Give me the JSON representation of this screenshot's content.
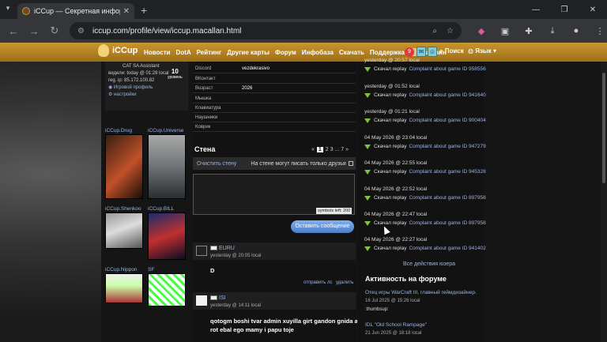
{
  "browser": {
    "tab_title": "iCCup — Секретная инфор",
    "url": "iccup.com/profile/view/iccup.macallan.html"
  },
  "sitenav": {
    "logo": "iCCup",
    "items": [
      "Новости",
      "DotA",
      "Рейтинг",
      "Другие карты",
      "Форум",
      "Инфобаза",
      "Скачать",
      "Поддержка",
      "Магазин"
    ],
    "badge": "9",
    "search": "Поиск",
    "lang": "Язык"
  },
  "profile": {
    "role": "CAT SA Assistant",
    "seen": "видели: today @ 01:28 local",
    "reg": "reg. ip: 85.172.100.82",
    "link1": "Игровой профиль",
    "link2": "настройки",
    "level": "10",
    "level_label": "уровень"
  },
  "friends": [
    {
      "name": "iCCup.Drug"
    },
    {
      "name": "iCCup.Universe"
    },
    {
      "name": "iCCup.Shenkoo"
    },
    {
      "name": "iCCup.BILL"
    },
    {
      "name": "iCCup.Nippon"
    },
    {
      "name": "SF"
    }
  ],
  "info_rows": [
    {
      "k": "Discord",
      "v": "vezdekrasivo"
    },
    {
      "k": "ВКонтакт",
      "v": ""
    },
    {
      "k": "Возраст",
      "v": "2026"
    },
    {
      "k": "Мышка",
      "v": ""
    },
    {
      "k": "Клавиатура",
      "v": ""
    },
    {
      "k": "Наушники",
      "v": ""
    },
    {
      "k": "Коврик",
      "v": ""
    }
  ],
  "wall": {
    "title": "Стена",
    "pag_prev": "«",
    "pag_1": "1",
    "pag_2": "2",
    "pag_3": "3",
    "pag_dots": "...",
    "pag_7": "7",
    "pag_next": "»",
    "clear": "Очистить стену",
    "friends_only": "На стене могут писать только друзья",
    "symbols": "symbols left: 200",
    "send": "Оставить сообщение"
  },
  "posts": [
    {
      "author": "EURU",
      "date": "yesterday @ 20:05 local",
      "text": "D",
      "reply": "отправить лс",
      "del": "удалить"
    },
    {
      "author": "ISI",
      "date": "yesterday @ 14:11 local",
      "text1": "qotogm boshi tvar admin xuyilla girt gandon gnida admin",
      "text2": "rot ebal ego mamy i papu toje"
    }
  ],
  "events": [
    {
      "t": "yesterday @ 20:57 local",
      "id": "958556"
    },
    {
      "t": "yesterday @ 01:52 local",
      "id": "941640"
    },
    {
      "t": "yesterday @ 01:21 local",
      "id": "900404"
    },
    {
      "t": "04 May 2026 @ 23:04 local",
      "id": "947279"
    },
    {
      "t": "04 May 2026 @ 22:55 local",
      "id": "945328"
    },
    {
      "t": "04 May 2026 @ 22:52 local",
      "id": "897958"
    },
    {
      "t": "04 May 2026 @ 22:47 local",
      "id": "897958"
    },
    {
      "t": "04 May 2026 @ 22:27 local",
      "id": "941402"
    }
  ],
  "event_action": "Скачал replay",
  "event_link": "Complaint about game ID",
  "all_actions": "Все действия юзера",
  "forum": {
    "title": "Активность на форуме",
    "items": [
      {
        "t": "Отец игры WarCraft III, главный геймдизайнер.",
        "d": "16 Jul 2025 @ 15:26 local",
        "b": ":thumbsup:"
      },
      {
        "t": "IDL \"Old School Rampage\"",
        "d": "21 Jun 2025 @ 18:18 local",
        "b": ""
      }
    ]
  }
}
